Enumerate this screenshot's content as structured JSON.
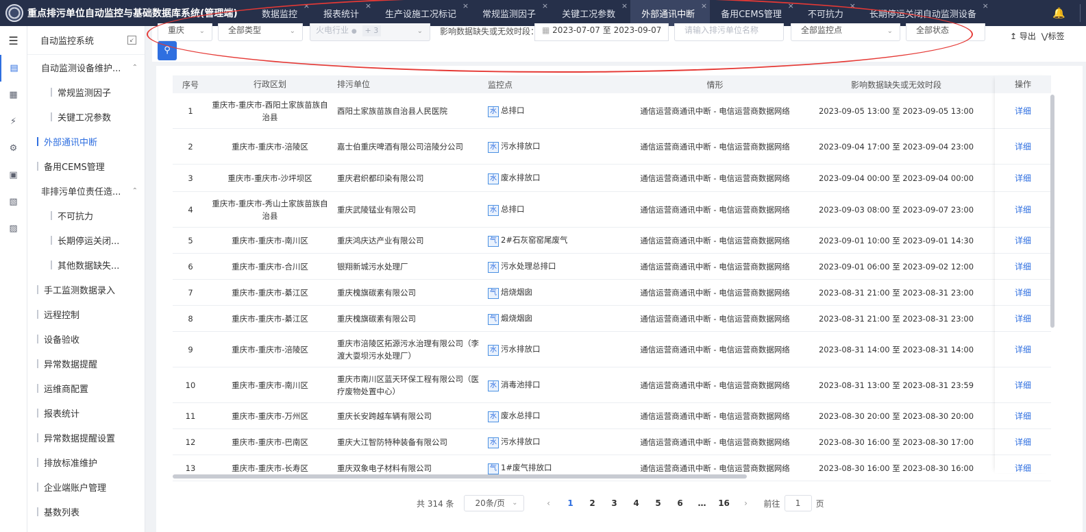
{
  "app": {
    "title": "重点排污单位自动监控与基础数据库系统(管理端)"
  },
  "tabs": [
    {
      "label": "数据监控",
      "active": false
    },
    {
      "label": "报表统计",
      "active": false
    },
    {
      "label": "生产设施工况标记",
      "active": false
    },
    {
      "label": "常规监测因子",
      "active": false
    },
    {
      "label": "关键工况参数",
      "active": false
    },
    {
      "label": "外部通讯中断",
      "active": true
    },
    {
      "label": "备用CEMS管理",
      "active": false
    },
    {
      "label": "不可抗力",
      "active": false
    },
    {
      "label": "长期停运关闭自动监测设备",
      "active": false
    }
  ],
  "sidebar": {
    "title": "自动监控系统",
    "items": [
      {
        "label": "自动监测设备维护...",
        "type": "group"
      },
      {
        "label": "常规监测因子",
        "type": "sub"
      },
      {
        "label": "关键工况参数",
        "type": "sub"
      },
      {
        "label": "外部通讯中断",
        "type": "item",
        "active": true
      },
      {
        "label": "备用CEMS管理",
        "type": "item"
      },
      {
        "label": "非排污单位责任造...",
        "type": "group"
      },
      {
        "label": "不可抗力",
        "type": "sub"
      },
      {
        "label": "长期停运关闭...",
        "type": "sub"
      },
      {
        "label": "其他数据缺失...",
        "type": "sub"
      },
      {
        "label": "手工监测数据录入",
        "type": "item"
      },
      {
        "label": "远程控制",
        "type": "item"
      },
      {
        "label": "设备验收",
        "type": "item"
      },
      {
        "label": "异常数据提醒",
        "type": "item"
      },
      {
        "label": "运维商配置",
        "type": "item"
      },
      {
        "label": "报表统计",
        "type": "item"
      },
      {
        "label": "异常数据提醒设置",
        "type": "item"
      },
      {
        "label": "排放标准维护",
        "type": "item"
      },
      {
        "label": "企业端账户管理",
        "type": "item"
      },
      {
        "label": "基数列表",
        "type": "item"
      }
    ]
  },
  "filters": {
    "region": "重庆",
    "type": "全部类型",
    "industry": "火电行业",
    "industry_more": "+ 3",
    "period_label": "影响数据缺失或无效时段：",
    "date_start": "2023-07-07",
    "date_sep": "至",
    "date_end": "2023-09-07",
    "org_placeholder": "请输入排污单位名称",
    "point": "全部监控点",
    "status": "全部状态",
    "export_label": "导出",
    "tag_label": "标签"
  },
  "table": {
    "headers": {
      "idx": "序号",
      "region": "行政区划",
      "org": "排污单位",
      "point": "监控点",
      "situation": "情形",
      "period": "影响数据缺失或无效时段",
      "op": "操作"
    },
    "op_label": "详细",
    "rows": [
      {
        "idx": "1",
        "region": "重庆市-重庆市-酉阳土家族苗族自治县",
        "org": "酉阳土家族苗族自治县人民医院",
        "badge": "水",
        "point": "总排口",
        "situation": "通信运营商通讯中断 - 电信运营商数据网络",
        "period": "2023-09-05 13:00 至 2023-09-05 13:00"
      },
      {
        "idx": "2",
        "region": "重庆市-重庆市-涪陵区",
        "org": "嘉士伯重庆啤酒有限公司涪陵分公司",
        "badge": "水",
        "point": "污水排放口",
        "situation": "通信运营商通讯中断 - 电信运营商数据网络",
        "period": "2023-09-04 17:00 至 2023-09-04 23:00"
      },
      {
        "idx": "3",
        "region": "重庆市-重庆市-沙坪坝区",
        "org": "重庆君织都印染有限公司",
        "badge": "水",
        "point": "废水排放口",
        "situation": "通信运营商通讯中断 - 电信运营商数据网络",
        "period": "2023-09-04 00:00 至 2023-09-04 00:00"
      },
      {
        "idx": "4",
        "region": "重庆市-重庆市-秀山土家族苗族自治县",
        "org": "重庆武陵锰业有限公司",
        "badge": "水",
        "point": "总排口",
        "situation": "通信运营商通讯中断 - 电信运营商数据网络",
        "period": "2023-09-03 08:00 至 2023-09-07 23:00"
      },
      {
        "idx": "5",
        "region": "重庆市-重庆市-南川区",
        "org": "重庆鸿庆达产业有限公司",
        "badge": "气",
        "point": "2#石灰窑窑尾废气",
        "situation": "通信运营商通讯中断 - 电信运营商数据网络",
        "period": "2023-09-01 10:00 至 2023-09-01 14:30"
      },
      {
        "idx": "6",
        "region": "重庆市-重庆市-合川区",
        "org": "银翔新城污水处理厂",
        "badge": "水",
        "point": "污水处理总排口",
        "situation": "通信运营商通讯中断 - 电信运营商数据网络",
        "period": "2023-09-01 06:00 至 2023-09-02 12:00"
      },
      {
        "idx": "7",
        "region": "重庆市-重庆市-綦江区",
        "org": "重庆槐旗碳素有限公司",
        "badge": "气",
        "point": "焙烧烟囱",
        "situation": "通信运营商通讯中断 - 电信运营商数据网络",
        "period": "2023-08-31 21:00 至 2023-08-31 23:00"
      },
      {
        "idx": "8",
        "region": "重庆市-重庆市-綦江区",
        "org": "重庆槐旗碳素有限公司",
        "badge": "气",
        "point": "煅烧烟囱",
        "situation": "通信运营商通讯中断 - 电信运营商数据网络",
        "period": "2023-08-31 21:00 至 2023-08-31 23:00"
      },
      {
        "idx": "9",
        "region": "重庆市-重庆市-涪陵区",
        "org": "重庆市涪陵区拓源污水治理有限公司（李渡大耍坝污水处理厂）",
        "badge": "水",
        "point": "污水排放口",
        "situation": "通信运营商通讯中断 - 电信运营商数据网络",
        "period": "2023-08-31 14:00 至 2023-08-31 14:00"
      },
      {
        "idx": "10",
        "region": "重庆市-重庆市-南川区",
        "org": "重庆市南川区蓝天环保工程有限公司（医疗废物处置中心）",
        "badge": "水",
        "point": "消毒池排口",
        "situation": "通信运营商通讯中断 - 电信运营商数据网络",
        "period": "2023-08-31 13:00 至 2023-08-31 23:59"
      },
      {
        "idx": "11",
        "region": "重庆市-重庆市-万州区",
        "org": "重庆长安跨越车辆有限公司",
        "badge": "水",
        "point": "废水总排口",
        "situation": "通信运营商通讯中断 - 电信运营商数据网络",
        "period": "2023-08-30 20:00 至 2023-08-30 20:00"
      },
      {
        "idx": "12",
        "region": "重庆市-重庆市-巴南区",
        "org": "重庆大江智防特种装备有限公司",
        "badge": "水",
        "point": "污水排放口",
        "situation": "通信运营商通讯中断 - 电信运营商数据网络",
        "period": "2023-08-30 16:00 至 2023-08-30 17:00"
      },
      {
        "idx": "13",
        "region": "重庆市-重庆市-长寿区",
        "org": "重庆双象电子材料有限公司",
        "badge": "气",
        "point": "1#废气排放口",
        "situation": "通信运营商通讯中断 - 电信运营商数据网络",
        "period": "2023-08-30 16:00 至 2023-08-30 16:00"
      }
    ]
  },
  "pagination": {
    "total_text": "共 314 条",
    "page_size": "20条/页",
    "pages": [
      "1",
      "2",
      "3",
      "4",
      "5",
      "6",
      "…",
      "16"
    ],
    "current": "1",
    "goto_label": "前往",
    "goto_value": "1",
    "goto_suffix": "页"
  }
}
